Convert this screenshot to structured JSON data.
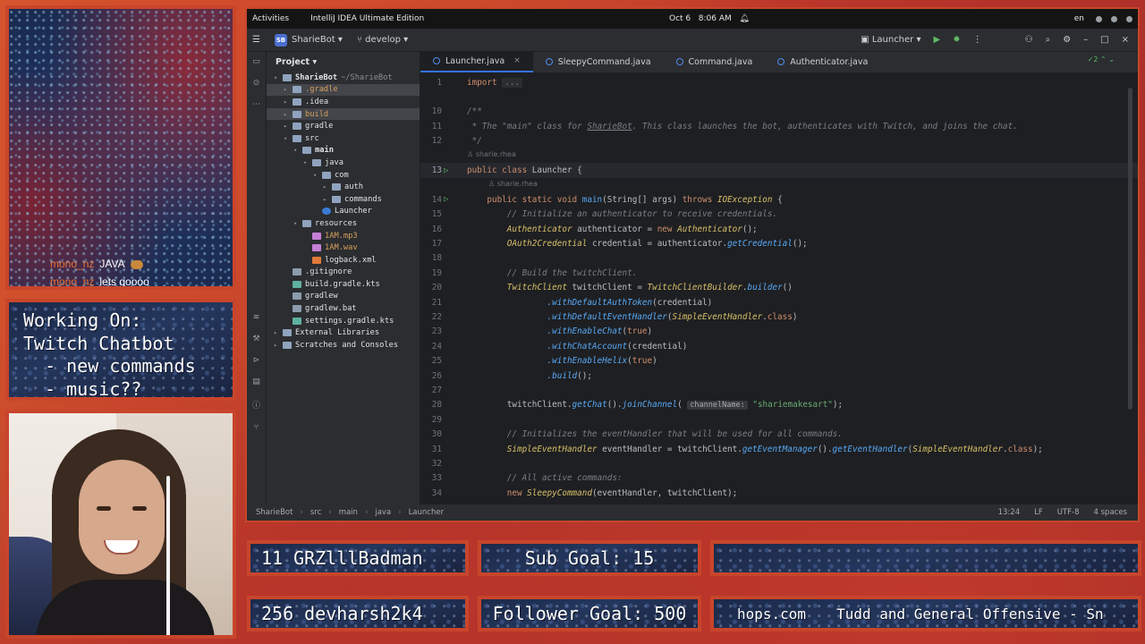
{
  "chat": {
    "messages": [
      {
        "user": "mono_nz",
        "text": "JAVA"
      },
      {
        "user": "mono_nz",
        "text": "lets goooo"
      }
    ]
  },
  "working_on": {
    "text": "Working On:\nTwitch Chatbot\n  - new commands\n  - music??"
  },
  "bottom_bar": {
    "latest_sub": "11 GRZlllBadman",
    "sub_goal": "Sub Goal: 15",
    "latest_follow": "256 devharsh2k4",
    "follower_goal": "Follower Goal: 500",
    "site": "hops.com",
    "now_playing": "Tudd and General Offensive - Snowma"
  },
  "system_bar": {
    "activities": "Activities",
    "app_name": "IntelliJ IDEA Ultimate Edition",
    "date": "Oct 6",
    "time": "8:06 AM",
    "lang": "en"
  },
  "toolbar": {
    "project_badge": "SB",
    "project_name": "SharieBot",
    "branch": "develop",
    "run_config": "Launcher"
  },
  "project_panel": {
    "title": "Project",
    "tree": [
      {
        "label": "SharieBot",
        "extra": "~/SharieBot",
        "depth": 0,
        "arrow": "▾",
        "icon": "dir",
        "sel": false,
        "bold": true
      },
      {
        "label": ".gradle",
        "depth": 1,
        "arrow": "▸",
        "icon": "dir",
        "sel": true,
        "color": "orange"
      },
      {
        "label": ".idea",
        "depth": 1,
        "arrow": "▸",
        "icon": "dir"
      },
      {
        "label": "build",
        "depth": 1,
        "arrow": "▸",
        "icon": "dir",
        "sel": true,
        "color": "orange"
      },
      {
        "label": "gradle",
        "depth": 1,
        "arrow": "▸",
        "icon": "dir"
      },
      {
        "label": "src",
        "depth": 1,
        "arrow": "▾",
        "icon": "dir"
      },
      {
        "label": "main",
        "depth": 2,
        "arrow": "▾",
        "icon": "dir",
        "bold": true
      },
      {
        "label": "java",
        "depth": 3,
        "arrow": "▾",
        "icon": "dir"
      },
      {
        "label": "com",
        "depth": 4,
        "arrow": "▾",
        "icon": "dir"
      },
      {
        "label": "auth",
        "depth": 5,
        "arrow": "▸",
        "icon": "dir"
      },
      {
        "label": "commands",
        "depth": 5,
        "arrow": "▸",
        "icon": "dir"
      },
      {
        "label": "Launcher",
        "depth": 4,
        "arrow": "",
        "icon": "java"
      },
      {
        "label": "resources",
        "depth": 2,
        "arrow": "▾",
        "icon": "dir"
      },
      {
        "label": "1AM.mp3",
        "depth": 3,
        "arrow": "",
        "icon": "snd",
        "color": "orange"
      },
      {
        "label": "1AM.wav",
        "depth": 3,
        "arrow": "",
        "icon": "snd",
        "color": "orange"
      },
      {
        "label": "logback.xml",
        "depth": 3,
        "arrow": "",
        "icon": "xml"
      },
      {
        "label": ".gitignore",
        "depth": 1,
        "arrow": "",
        "icon": "file"
      },
      {
        "label": "build.gradle.kts",
        "depth": 1,
        "arrow": "",
        "icon": "gradle"
      },
      {
        "label": "gradlew",
        "depth": 1,
        "arrow": "",
        "icon": "file"
      },
      {
        "label": "gradlew.bat",
        "depth": 1,
        "arrow": "",
        "icon": "file"
      },
      {
        "label": "settings.gradle.kts",
        "depth": 1,
        "arrow": "",
        "icon": "gradle"
      },
      {
        "label": "External Libraries",
        "depth": 0,
        "arrow": "▸",
        "icon": "dir"
      },
      {
        "label": "Scratches and Consoles",
        "depth": 0,
        "arrow": "▸",
        "icon": "dir"
      }
    ]
  },
  "tabs": [
    {
      "label": "Launcher.java",
      "active": true
    },
    {
      "label": "SleepyCommand.java",
      "active": false
    },
    {
      "label": "Command.java",
      "active": false
    },
    {
      "label": "Authenticator.java",
      "active": false
    }
  ],
  "inspection": "✓2",
  "code": {
    "author": "sharie.rhea",
    "import_placeholder": "...",
    "line_numbers": [
      "1",
      "10",
      "11",
      "12",
      "13",
      "14",
      "15",
      "16",
      "17",
      "18",
      "19",
      "20",
      "21",
      "22",
      "23",
      "24",
      "25",
      "26",
      "27",
      "28",
      "29",
      "30",
      "31",
      "32",
      "33",
      "34"
    ],
    "channel_hint": "channelName:",
    "channel": "\"shariemakesart\""
  },
  "statusbar": {
    "crumbs": [
      "SharieBot",
      "src",
      "main",
      "java",
      "Launcher"
    ],
    "position": "13:24",
    "line_sep": "LF",
    "encoding": "UTF-8",
    "indent": "4 spaces"
  }
}
